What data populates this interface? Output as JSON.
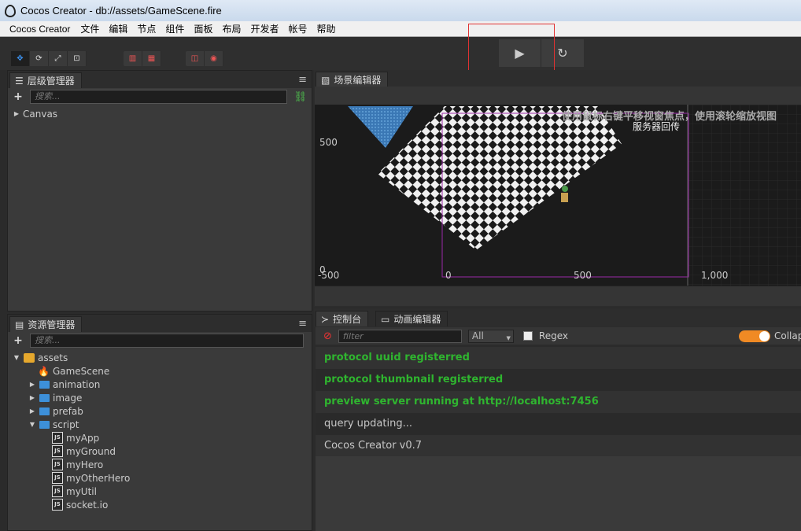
{
  "window": {
    "title": "Cocos Creator - db://assets/GameScene.fire"
  },
  "menubar": [
    "Cocos Creator",
    "文件",
    "编辑",
    "节点",
    "组件",
    "面板",
    "布局",
    "开发者",
    "帐号",
    "帮助"
  ],
  "toolbar": {
    "transform_tools": [
      "move-tool",
      "rotate-tool",
      "scale-tool",
      "rect-tool"
    ],
    "play_button": "▶",
    "reload_button": "↻"
  },
  "hierarchy": {
    "tab_title": "层级管理器",
    "search_placeholder": "搜索...",
    "nodes": [
      "Canvas"
    ]
  },
  "assets": {
    "tab_title": "资源管理器",
    "search_placeholder": "搜索...",
    "tree": {
      "root": "assets",
      "items": [
        {
          "label": "GameScene",
          "type": "scene",
          "indent": 1,
          "expander": ""
        },
        {
          "label": "animation",
          "type": "folder",
          "indent": 1,
          "expander": "▶"
        },
        {
          "label": "image",
          "type": "folder",
          "indent": 1,
          "expander": "▶"
        },
        {
          "label": "prefab",
          "type": "folder",
          "indent": 1,
          "expander": "▶"
        },
        {
          "label": "script",
          "type": "folder",
          "indent": 1,
          "expander": "▼"
        },
        {
          "label": "myApp",
          "type": "js",
          "indent": 2
        },
        {
          "label": "myGround",
          "type": "js",
          "indent": 2
        },
        {
          "label": "myHero",
          "type": "js",
          "indent": 2
        },
        {
          "label": "myOtherHero",
          "type": "js",
          "indent": 2
        },
        {
          "label": "myUtil",
          "type": "js",
          "indent": 2
        },
        {
          "label": "socket.io",
          "type": "js",
          "indent": 2
        }
      ]
    }
  },
  "scene": {
    "tab_title": "场景编辑器",
    "hint": "使用鼠标右键平移视窗焦点，使用滚轮缩放视图",
    "overlay_label": "服务器回传",
    "axis_labels": {
      "y_500": "500",
      "y_0": "0",
      "x_neg500": "-500",
      "x_0": "0",
      "x_500": "500",
      "x_1000": "1,000"
    }
  },
  "console": {
    "tabs": [
      "控制台",
      "动画编辑器"
    ],
    "filter_placeholder": "filter",
    "level": "All",
    "regex_label": "Regex",
    "collapse_label": "Collapse",
    "logs": [
      {
        "text": "protocol uuid registerred",
        "kind": "success"
      },
      {
        "text": "protocol thumbnail registerred",
        "kind": "success"
      },
      {
        "text": "preview server running at http://localhost:7456",
        "kind": "success"
      },
      {
        "text": "query updating...",
        "kind": "info"
      },
      {
        "text": "Cocos Creator v0.7",
        "kind": "info"
      }
    ]
  },
  "colors": {
    "accent": "#3b8ee8",
    "success": "#2fb52f",
    "toggle": "#f08a24",
    "highlight": "#e03232"
  }
}
